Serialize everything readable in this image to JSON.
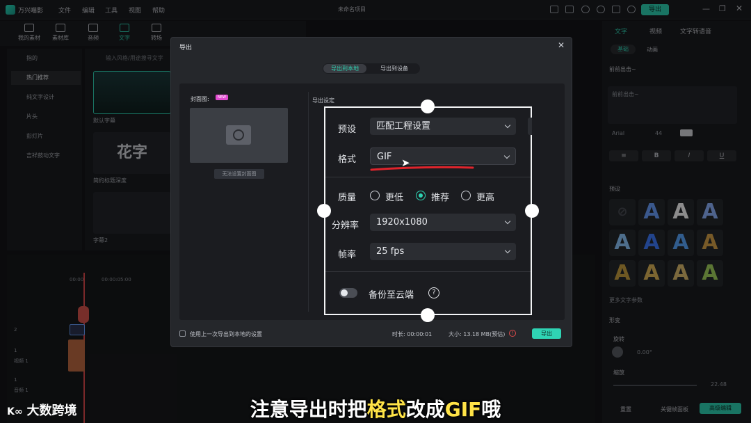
{
  "app": {
    "title": "万兴喵影",
    "project": "未命名项目",
    "export_label": "导出",
    "menu": [
      "文件",
      "编辑",
      "工具",
      "视图",
      "帮助"
    ]
  },
  "toolbar": {
    "items": [
      {
        "label": "我的素材",
        "icon": "folder-icon"
      },
      {
        "label": "素材库",
        "icon": "image-icon"
      },
      {
        "label": "音频",
        "icon": "music-icon"
      },
      {
        "label": "文字",
        "icon": "text-icon"
      },
      {
        "label": "转场",
        "icon": "transition-icon"
      }
    ]
  },
  "left_categories": [
    "指的",
    "热门推荐",
    "纯文字设计",
    "片头",
    "彭灯片",
    "吉祥鼓动文字"
  ],
  "library": {
    "search_placeholder": "输入风格/用途搜寻文字",
    "items": [
      "默认字幕",
      "简约标题深度",
      "字幕2"
    ],
    "thumb_text": "花字"
  },
  "right_panel": {
    "tabs": [
      "文字",
      "视频",
      "文字转语音"
    ],
    "subtabs": [
      "基础",
      "动画"
    ],
    "field_label": "前前出击~",
    "field_value": "前前出击~",
    "font": "Arial",
    "size": "44",
    "format_buttons": [
      "B",
      "I",
      "U"
    ],
    "preset_label": "预设",
    "more_params": "更多文字参数",
    "transform": "形变",
    "rotate": "旋转",
    "rotate_value": "0.00°",
    "scale": "缩放",
    "scale_value": "22.48",
    "reset": "重置",
    "keyframe": "关键帧面板",
    "advanced": "高级编辑",
    "preset_glyph": "A"
  },
  "timeline": {
    "time1": "00:00",
    "time2": "00:00:05:00",
    "tracks": [
      "2",
      "1",
      "1"
    ],
    "track_sub": [
      "视频 1",
      "音频 1"
    ]
  },
  "dialog": {
    "title": "导出",
    "tabs": {
      "local": "导出到本地",
      "device": "导出到设备"
    },
    "cover_label": "封面图:",
    "new_badge": "NEW",
    "cover_button": "无法设置封面图",
    "settings_label": "导出设定",
    "use_last": "使用上一次导出到本地的设置",
    "duration": "时长: 00:00:01",
    "size": "大小: 13.18 MB(预估)",
    "export": "导出"
  },
  "zoom": {
    "preset_label": "预设",
    "preset_value": "匹配工程设置",
    "format_label": "格式",
    "format_value": "GIF",
    "quality_label": "质量",
    "quality_options": [
      "更低",
      "推荐",
      "更高"
    ],
    "quality_selected": "推荐",
    "resolution_label": "分辨率",
    "resolution_value": "1920x1080",
    "fps_label": "帧率",
    "fps_value": "25 fps",
    "cloud_label": "备份至云端",
    "help": "?"
  },
  "subtitle": {
    "part1": "注意导出时把",
    "part2": "格式",
    "part3": "改成",
    "part4": "GIF",
    "part5": "哦"
  },
  "watermark": "大数跨境"
}
